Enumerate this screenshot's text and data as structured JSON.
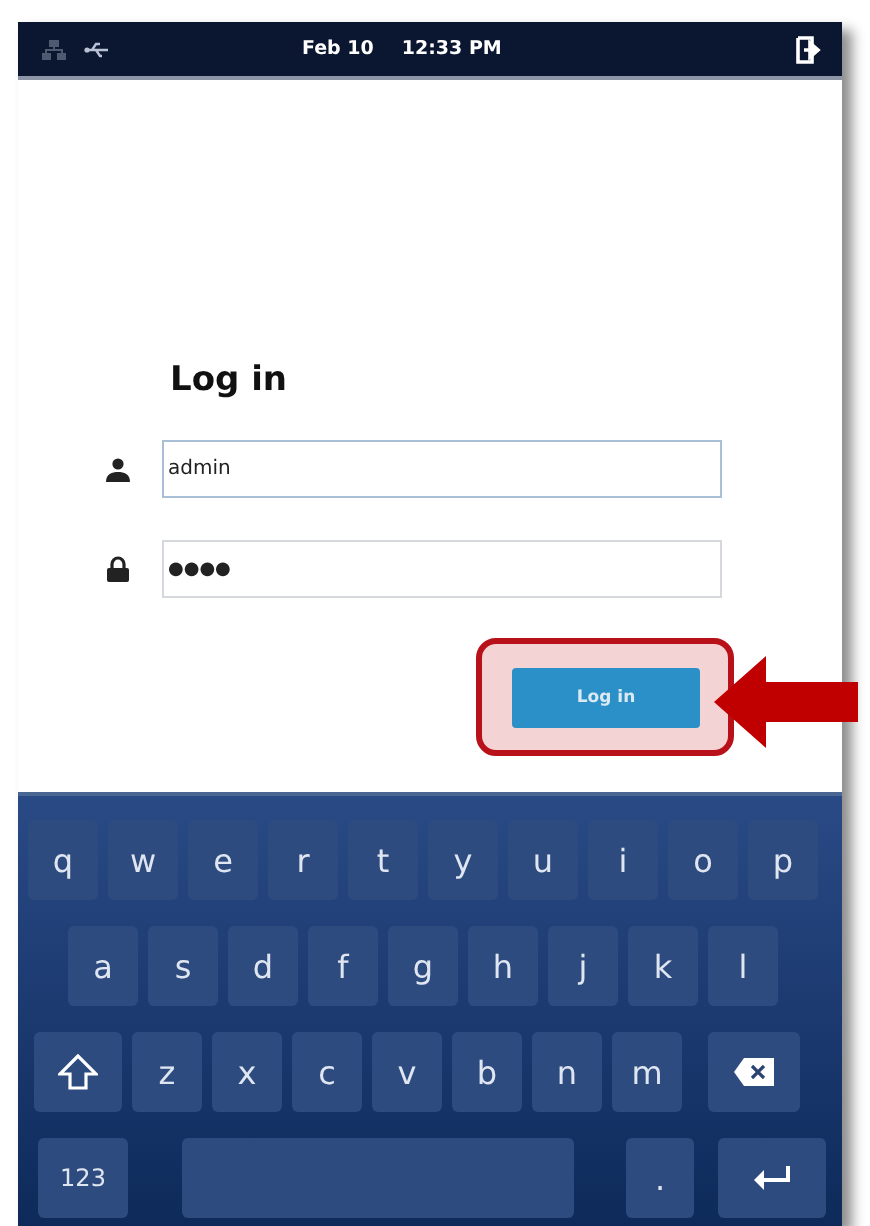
{
  "status_bar": {
    "date": "Feb 10",
    "time": "12:33 PM",
    "network_connected": false
  },
  "login": {
    "title": "Log in",
    "fields": [
      {
        "kind": "user",
        "value": "admin",
        "focused": true
      },
      {
        "kind": "password",
        "value": "●●●●",
        "focused": false
      }
    ],
    "button": "Log in",
    "highlighted": true
  },
  "keyboard": [
    [
      {
        "kind": "char",
        "label": "q"
      },
      {
        "kind": "char",
        "label": "w"
      },
      {
        "kind": "char",
        "label": "e"
      },
      {
        "kind": "char",
        "label": "r"
      },
      {
        "kind": "char",
        "label": "t"
      },
      {
        "kind": "char",
        "label": "y"
      },
      {
        "kind": "char",
        "label": "u"
      },
      {
        "kind": "char",
        "label": "i"
      },
      {
        "kind": "char",
        "label": "o"
      },
      {
        "kind": "char",
        "label": "p"
      }
    ],
    [
      {
        "kind": "char",
        "label": "a"
      },
      {
        "kind": "char",
        "label": "s"
      },
      {
        "kind": "char",
        "label": "d"
      },
      {
        "kind": "char",
        "label": "f"
      },
      {
        "kind": "char",
        "label": "g"
      },
      {
        "kind": "char",
        "label": "h"
      },
      {
        "kind": "char",
        "label": "j"
      },
      {
        "kind": "char",
        "label": "k"
      },
      {
        "kind": "char",
        "label": "l"
      }
    ],
    [
      {
        "kind": "shift"
      },
      {
        "kind": "char",
        "label": "z"
      },
      {
        "kind": "char",
        "label": "x"
      },
      {
        "kind": "char",
        "label": "c"
      },
      {
        "kind": "char",
        "label": "v"
      },
      {
        "kind": "char",
        "label": "b"
      },
      {
        "kind": "char",
        "label": "n"
      },
      {
        "kind": "char",
        "label": "m"
      },
      {
        "kind": "backspace"
      }
    ],
    [
      {
        "kind": "mode",
        "label": "123"
      },
      {
        "kind": "space"
      },
      {
        "kind": "char",
        "label": "."
      },
      {
        "kind": "enter"
      }
    ]
  ]
}
